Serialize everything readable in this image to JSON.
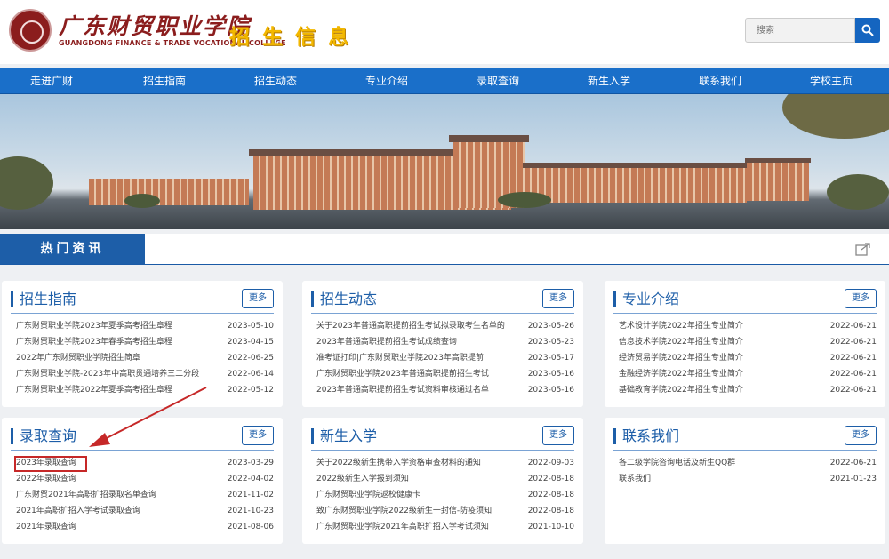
{
  "header": {
    "logo_cn": "广东财贸职业学院",
    "logo_en": "GUANGDONG FINANCE & TRADE VOCATIONAL COLLEGE",
    "title": "招生信息",
    "search_placeholder": "搜索"
  },
  "nav": [
    "走进广财",
    "招生指南",
    "招生动态",
    "专业介绍",
    "录取查询",
    "新生入学",
    "联系我们",
    "学校主页"
  ],
  "hot_tab": "热门资讯",
  "more_label": "更多",
  "panels": [
    {
      "title": "招生指南",
      "items": [
        {
          "text": "广东财贸职业学院2023年夏季高考招生章程",
          "date": "2023-05-10"
        },
        {
          "text": "广东财贸职业学院2023年春季高考招生章程",
          "date": "2023-04-15"
        },
        {
          "text": "2022年广东财贸职业学院招生简章",
          "date": "2022-06-25"
        },
        {
          "text": "广东财贸职业学院-2023年中高职贯通培养三二分段",
          "date": "2022-06-14"
        },
        {
          "text": "广东财贸职业学院2022年夏季高考招生章程",
          "date": "2022-05-12"
        }
      ]
    },
    {
      "title": "招生动态",
      "items": [
        {
          "text": "关于2023年普通高职提前招生考试拟录取考生名单的",
          "date": "2023-05-26"
        },
        {
          "text": "2023年普通高职提前招生考试成绩查询",
          "date": "2023-05-23"
        },
        {
          "text": "准考证打印|广东财贸职业学院2023年高职提前",
          "date": "2023-05-17"
        },
        {
          "text": "广东财贸职业学院2023年普通高职提前招生考试",
          "date": "2023-05-16"
        },
        {
          "text": "2023年普通高职提前招生考试资料审核通过名单",
          "date": "2023-05-16"
        }
      ]
    },
    {
      "title": "专业介绍",
      "items": [
        {
          "text": "艺术设计学院2022年招生专业简介",
          "date": "2022-06-21"
        },
        {
          "text": "信息技术学院2022年招生专业简介",
          "date": "2022-06-21"
        },
        {
          "text": "经济贸易学院2022年招生专业简介",
          "date": "2022-06-21"
        },
        {
          "text": "金融经济学院2022年招生专业简介",
          "date": "2022-06-21"
        },
        {
          "text": "基础教育学院2022年招生专业简介",
          "date": "2022-06-21"
        }
      ]
    },
    {
      "title": "录取查询",
      "items": [
        {
          "text": "2023年录取查询",
          "date": "2023-03-29"
        },
        {
          "text": "2022年录取查询",
          "date": "2022-04-02"
        },
        {
          "text": "广东财贸2021年高职扩招录取名单查询",
          "date": "2021-11-02"
        },
        {
          "text": "2021年高职扩招入学考试录取查询",
          "date": "2021-10-23"
        },
        {
          "text": "2021年录取查询",
          "date": "2021-08-06"
        }
      ]
    },
    {
      "title": "新生入学",
      "items": [
        {
          "text": "关于2022级新生携带入学资格审查材料的通知",
          "date": "2022-09-03"
        },
        {
          "text": "2022级新生入学报到须知",
          "date": "2022-08-18"
        },
        {
          "text": "广东财贸职业学院返校健康卡",
          "date": "2022-08-18"
        },
        {
          "text": "致广东财贸职业学院2022级新生一封信-防疫须知",
          "date": "2022-08-18"
        },
        {
          "text": "广东财贸职业学院2021年高职扩招入学考试须知",
          "date": "2021-10-10"
        }
      ]
    },
    {
      "title": "联系我们",
      "items": [
        {
          "text": "各二级学院咨询电话及新生QQ群",
          "date": "2022-06-21"
        },
        {
          "text": "联系我们",
          "date": "2021-01-23"
        }
      ]
    }
  ],
  "colors": {
    "nav_blue": "#1a6fc9",
    "hot_tab_blue": "#1d5ea8",
    "title_gold": "#f3b800",
    "logo_red": "#8b1d1d",
    "highlight_red": "#c62828"
  }
}
